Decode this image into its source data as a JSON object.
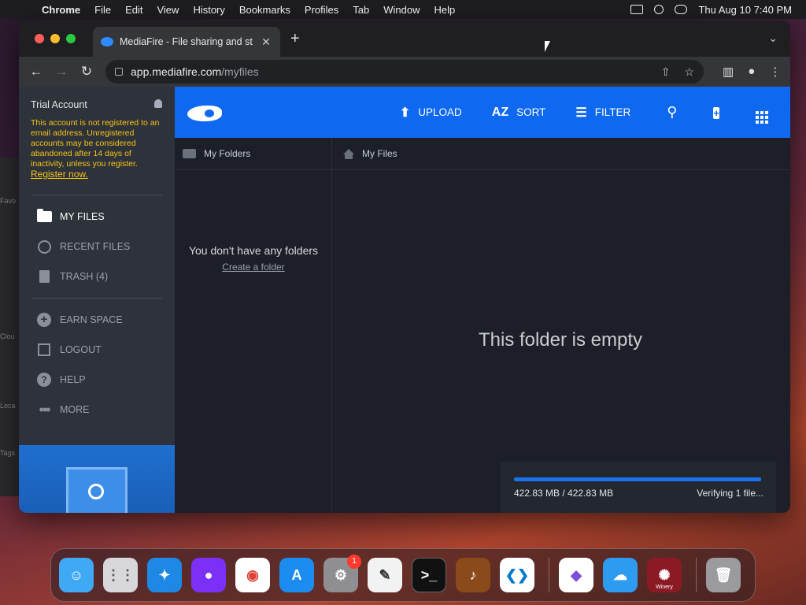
{
  "menubar": {
    "app": "Chrome",
    "items": [
      "File",
      "Edit",
      "View",
      "History",
      "Bookmarks",
      "Profiles",
      "Tab",
      "Window",
      "Help"
    ],
    "clock": "Thu Aug 10  7:40 PM"
  },
  "background": {
    "finder_labels": [
      "Favo",
      "Clou",
      "Loca",
      "Tags"
    ]
  },
  "browser": {
    "tab_title": "MediaFire - File sharing and st",
    "url_host": "app.mediafire.com",
    "url_path": "/myfiles"
  },
  "sidebar": {
    "account_title": "Trial Account",
    "account_note": "This account is not registered to an email address. Unregistered accounts may be considered abandoned after 14 days of inactivity, unless you register.",
    "register_link": "Register now.",
    "nav_items": [
      {
        "label": "MY FILES",
        "icon": "folder-icon",
        "active": true
      },
      {
        "label": "RECENT FILES",
        "icon": "clock-icon"
      },
      {
        "label": "TRASH (4)",
        "icon": "trash-icon"
      }
    ],
    "extra_items": [
      {
        "label": "EARN SPACE",
        "icon": "plus-circle-icon"
      },
      {
        "label": "LOGOUT",
        "icon": "logout-icon"
      },
      {
        "label": "HELP",
        "icon": "help-icon"
      },
      {
        "label": "MORE",
        "icon": "more-icon"
      }
    ]
  },
  "header": {
    "upload": "UPLOAD",
    "sort": "SORT",
    "sort_icon_text": "AZ",
    "filter": "FILTER"
  },
  "breadcrumbs": {
    "folders": "My Folders",
    "files": "My Files"
  },
  "folders_pane": {
    "empty_message": "You don't have any folders",
    "create_link": "Create a folder"
  },
  "files_pane": {
    "empty_message": "This folder is empty"
  },
  "upload_status": {
    "size": "422.83 MB / 422.83 MB",
    "status": "Verifying 1 file...",
    "progress": 1.0
  },
  "dock": {
    "settings_badge": "1",
    "winery_label": "Winery"
  },
  "colors": {
    "brand_blue": "#0f68f0",
    "warning_yellow": "#f5c518"
  }
}
